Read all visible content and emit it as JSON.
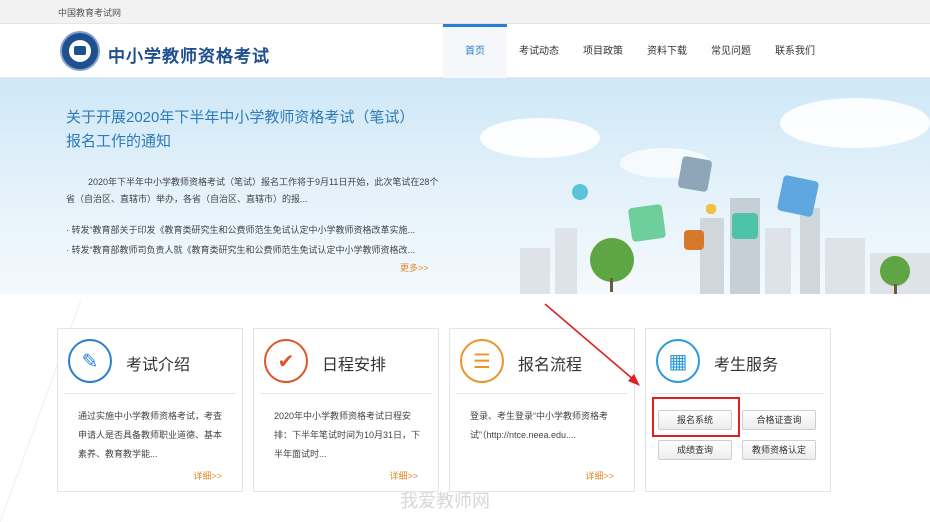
{
  "topbar": {
    "site_name": "中国教育考试网"
  },
  "header": {
    "title": "中小学教师资格考试",
    "nav": [
      {
        "label": "首页",
        "active": true
      },
      {
        "label": "考试动态"
      },
      {
        "label": "项目政策"
      },
      {
        "label": "资料下载"
      },
      {
        "label": "常见问题"
      },
      {
        "label": "联系我们"
      }
    ]
  },
  "banner": {
    "title": "关于开展2020年下半年中小学教师资格考试（笔试）报名工作的通知",
    "text": "2020年下半年中小学教师资格考试（笔试）报名工作将于9月11日开始，此次笔试在28个省（自治区、直辖市）举办，各省（自治区、直辖市）的报...",
    "links": [
      "· 转发“教育部关于印发《教育类研究生和公费师范生免试认定中小学教师资格改革实施...",
      "· 转发“教育部教师司负责人就《教育类研究生和公费师范生免试认定中小学教师资格改..."
    ],
    "more": "更多>>"
  },
  "cards": [
    {
      "title": "考试介绍",
      "desc": "通过实施中小学教师资格考试，考查申请人是否具备教师职业道德、基本素养、教育教学能...",
      "more": "详细>>",
      "icon": "document-icon",
      "color": "#2b7fd0"
    },
    {
      "title": "日程安排",
      "desc": "2020年中小学教师资格考试日程安排：下半年笔试时间为10月31日，下半年面试时...",
      "more": "详细>>",
      "icon": "checkmark-icon",
      "color": "#e0542a"
    },
    {
      "title": "报名流程",
      "desc": "登录、考生登录“中小学教师资格考试”（http://ntce.neea.edu....",
      "more": "详细>>",
      "icon": "form-icon",
      "color": "#e8962a"
    },
    {
      "title": "考生服务",
      "icon": "address-book-icon",
      "color": "#2b9ad8",
      "buttons": [
        "报名系统",
        "合格证查询",
        "成绩查询",
        "教师资格认定"
      ]
    }
  ],
  "annotation": {
    "color": "#e02020"
  },
  "watermark": "我爱教师网"
}
